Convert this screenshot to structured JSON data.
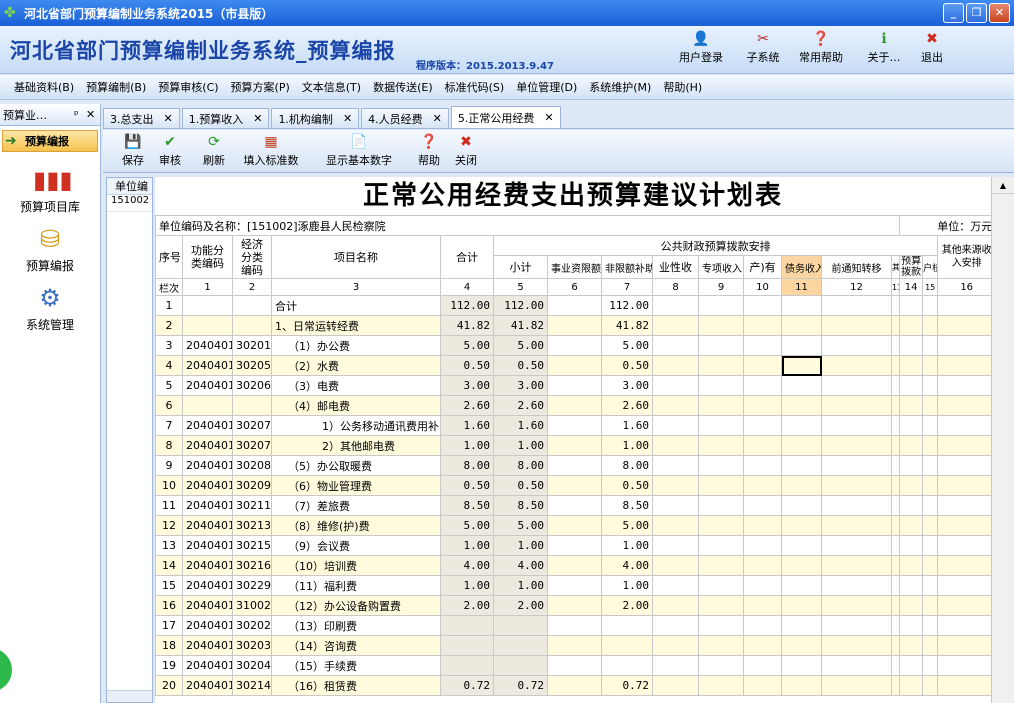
{
  "window": {
    "title": "河北省部门预算编制业务系统2015（市县版）"
  },
  "banner": {
    "title": "河北省部门预算编制业务系统_预算编报",
    "version": "程序版本：2015.2013.9.47",
    "buttons": [
      {
        "label": "用户登录",
        "icon": "user-icon"
      },
      {
        "label": "子系统",
        "icon": "tools-icon"
      },
      {
        "label": "常用帮助",
        "icon": "help-icon"
      },
      {
        "label": "关于…",
        "icon": "info-icon"
      },
      {
        "label": "退出",
        "icon": "exit-icon"
      }
    ]
  },
  "menu": [
    "基础资料(B)",
    "预算编制(B)",
    "预算审核(C)",
    "预算方案(P)",
    "文本信息(T)",
    "数据传送(E)",
    "标准代码(S)",
    "单位管理(D)",
    "系统维护(M)",
    "帮助(H)"
  ],
  "sidebar": {
    "header": "预算业…",
    "active": "预算编报",
    "items": [
      "预算项目库",
      "预算编报",
      "系统管理"
    ]
  },
  "tabs": [
    "3.总支出",
    "1.预算收入",
    "1.机构编制",
    "4.人员经费",
    "5.正常公用经费"
  ],
  "toolbar": [
    "保存",
    "审核",
    "刷新",
    "填入标准数",
    "显示基本数字",
    "帮助",
    "关闭"
  ],
  "leftgrid": {
    "header": "单位编",
    "row": "151002"
  },
  "sheet": {
    "title": "正常公用经费支出预算建议计划表",
    "unit_info": "单位编码及名称：[151002]涿鹿县人民检察院",
    "unit": "单位：万元",
    "h": {
      "seq": "序号",
      "func": "功能分类编码",
      "econ": "经济分类编码",
      "item": "项目名称",
      "total": "合计",
      "group": "公共财政预算拨款安排",
      "sub": [
        "小计",
        "事业资限额",
        "非限额补助",
        "业性收",
        "专项收入",
        "产)有",
        "债务收入",
        "前通知转移",
        "其他",
        "预算拨款",
        "户核",
        "其他来源收入安排"
      ]
    },
    "colnums": [
      "栏次",
      "1",
      "2",
      "3",
      "4",
      "5",
      "6",
      "7",
      "8",
      "9",
      "10",
      "11",
      "12",
      "13",
      "14",
      "15",
      "16"
    ],
    "rows": [
      {
        "n": "1",
        "f": "",
        "e": "",
        "name": "合计",
        "t": "112.00",
        "s": "112.00",
        "b": "112.00",
        "y": false
      },
      {
        "n": "2",
        "f": "",
        "e": "",
        "name": "1、日常运转经费",
        "t": "41.82",
        "s": "41.82",
        "b": "41.82",
        "y": true
      },
      {
        "n": "3",
        "f": "2040401",
        "e": "30201",
        "name": "（1）办公费",
        "t": "5.00",
        "s": "5.00",
        "b": "5.00",
        "y": false
      },
      {
        "n": "4",
        "f": "2040401",
        "e": "30205",
        "name": "（2）水费",
        "t": "0.50",
        "s": "0.50",
        "b": "0.50",
        "y": true
      },
      {
        "n": "5",
        "f": "2040401",
        "e": "30206",
        "name": "（3）电费",
        "t": "3.00",
        "s": "3.00",
        "b": "3.00",
        "y": false
      },
      {
        "n": "6",
        "f": "",
        "e": "",
        "name": "（4）邮电费",
        "t": "2.60",
        "s": "2.60",
        "b": "2.60",
        "y": true
      },
      {
        "n": "7",
        "f": "2040401",
        "e": "30207",
        "name": "1）公务移动通讯费用补",
        "t": "1.60",
        "s": "1.60",
        "b": "1.60",
        "y": false
      },
      {
        "n": "8",
        "f": "2040401",
        "e": "30207",
        "name": "2）其他邮电费",
        "t": "1.00",
        "s": "1.00",
        "b": "1.00",
        "y": true
      },
      {
        "n": "9",
        "f": "2040401",
        "e": "30208",
        "name": "（5）办公取暖费",
        "t": "8.00",
        "s": "8.00",
        "b": "8.00",
        "y": false
      },
      {
        "n": "10",
        "f": "2040401",
        "e": "30209",
        "name": "（6）物业管理费",
        "t": "0.50",
        "s": "0.50",
        "b": "0.50",
        "y": true
      },
      {
        "n": "11",
        "f": "2040401",
        "e": "30211",
        "name": "（7）差旅费",
        "t": "8.50",
        "s": "8.50",
        "b": "8.50",
        "y": false
      },
      {
        "n": "12",
        "f": "2040401",
        "e": "30213",
        "name": "（8）维修(护)费",
        "t": "5.00",
        "s": "5.00",
        "b": "5.00",
        "y": true
      },
      {
        "n": "13",
        "f": "2040401",
        "e": "30215",
        "name": "（9）会议费",
        "t": "1.00",
        "s": "1.00",
        "b": "1.00",
        "y": false
      },
      {
        "n": "14",
        "f": "2040401",
        "e": "30216",
        "name": "（10）培训费",
        "t": "4.00",
        "s": "4.00",
        "b": "4.00",
        "y": true
      },
      {
        "n": "15",
        "f": "2040401",
        "e": "30229",
        "name": "（11）福利费",
        "t": "1.00",
        "s": "1.00",
        "b": "1.00",
        "y": false
      },
      {
        "n": "16",
        "f": "2040401",
        "e": "31002",
        "name": "（12）办公设备购置费",
        "t": "2.00",
        "s": "2.00",
        "b": "2.00",
        "y": true
      },
      {
        "n": "17",
        "f": "2040401",
        "e": "30202",
        "name": "（13）印刷费",
        "t": "",
        "s": "",
        "b": "",
        "y": false
      },
      {
        "n": "18",
        "f": "2040401",
        "e": "30203",
        "name": "（14）咨询费",
        "t": "",
        "s": "",
        "b": "",
        "y": true
      },
      {
        "n": "19",
        "f": "2040401",
        "e": "30204",
        "name": "（15）手续费",
        "t": "",
        "s": "",
        "b": "",
        "y": false
      },
      {
        "n": "20",
        "f": "2040401",
        "e": "30214",
        "name": "（16）租赁费",
        "t": "0.72",
        "s": "0.72",
        "b": "0.72",
        "y": true
      }
    ]
  }
}
